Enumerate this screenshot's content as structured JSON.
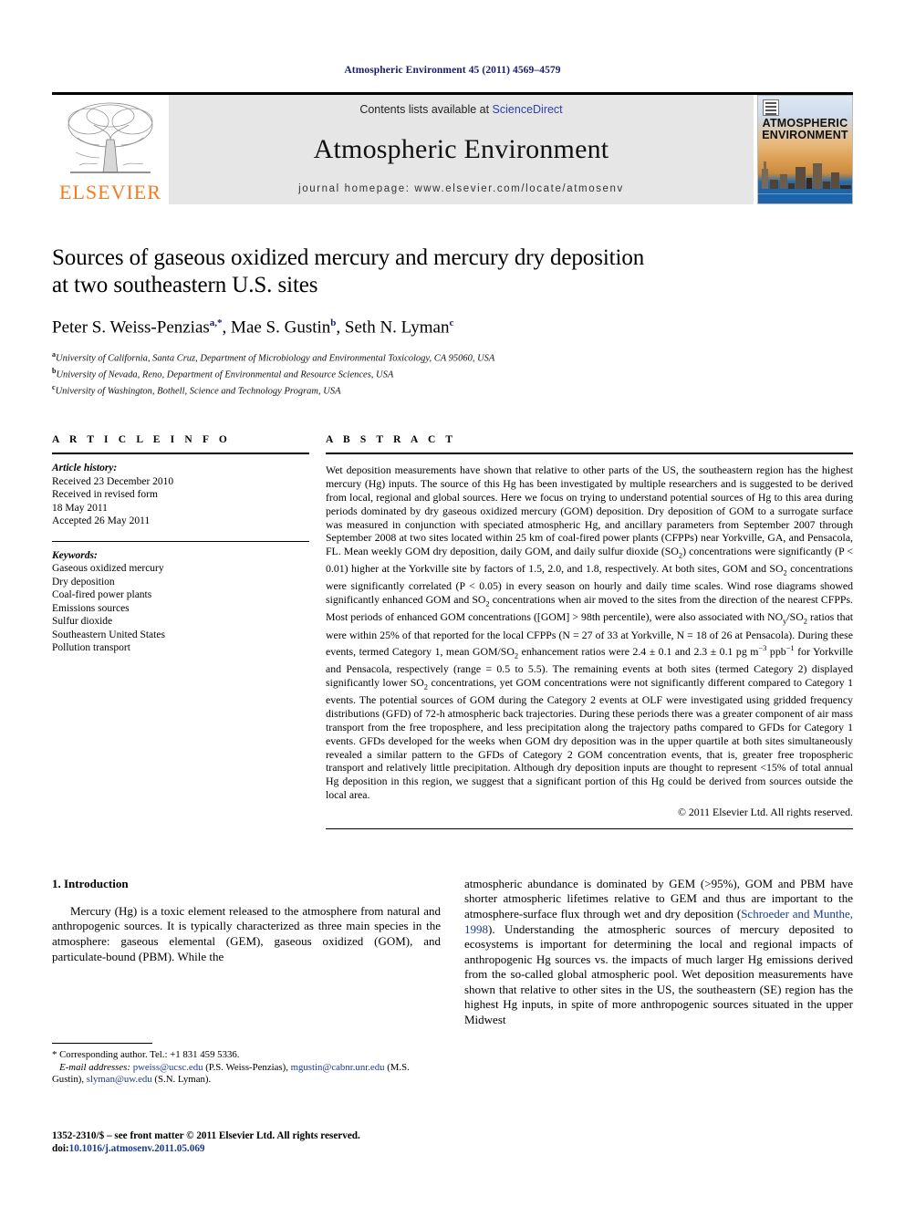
{
  "running_head": "Atmospheric Environment 45 (2011) 4569–4579",
  "masthead": {
    "publisher_name": "ELSEVIER",
    "contents_prefix": "Contents lists available at ",
    "sciencedirect": "ScienceDirect",
    "journal_title": "Atmospheric Environment",
    "homepage_line": "journal homepage: www.elsevier.com/locate/atmosenv",
    "cover_title_line1": "ATMOSPHERIC",
    "cover_title_line2": "ENVIRONMENT"
  },
  "article": {
    "title_line1": "Sources of gaseous oxidized mercury and mercury dry deposition",
    "title_line2": "at two southeastern U.S. sites",
    "authors_plain": "Peter S. Weiss-Penzias a,*, Mae S. Gustin b, Seth N. Lyman c",
    "affiliations": [
      "University of California, Santa Cruz, Department of Microbiology and Environmental Toxicology, CA 95060, USA",
      "University of Nevada, Reno, Department of Environmental and Resource Sciences, USA",
      "University of Washington, Bothell, Science and Technology Program, USA"
    ],
    "affiliation_marks": [
      "a",
      "b",
      "c"
    ]
  },
  "article_info": {
    "heading": "A R T I C L E    I N F O",
    "history_label": "Article history:",
    "history_lines": [
      "Received 23 December 2010",
      "Received in revised form",
      "18 May 2011",
      "Accepted 26 May 2011"
    ],
    "keywords_label": "Keywords:",
    "keywords": [
      "Gaseous oxidized mercury",
      "Dry deposition",
      "Coal-fired power plants",
      "Emissions sources",
      "Sulfur dioxide",
      "Southeastern United States",
      "Pollution transport"
    ]
  },
  "abstract": {
    "heading": "A B S T R A C T",
    "paragraph_part1": "Wet deposition measurements have shown that relative to other parts of the US, the southeastern region has the highest mercury (Hg) inputs. The source of this Hg has been investigated by multiple researchers and is suggested to be derived from local, regional and global sources. Here we focus on trying to understand potential sources of Hg to this area during periods dominated by dry gaseous oxidized mercury (GOM) deposition. Dry deposition of GOM to a surrogate surface was measured in conjunction with speciated atmospheric Hg, and ancillary parameters from September 2007 through September 2008 at two sites located within 25 km of coal-fired power plants (CFPPs) near Yorkville, GA, and Pensacola, FL. Mean weekly GOM dry deposition, daily GOM, and daily sulfur dioxide (SO",
    "paragraph_part2": ") concentrations were significantly (P < 0.01) higher at the Yorkville site by factors of 1.5, 2.0, and 1.8, respectively. At both sites, GOM and SO",
    "paragraph_part3": " concentrations were significantly correlated (P < 0.05) in every season on hourly and daily time scales. Wind rose diagrams showed significantly enhanced GOM and SO",
    "paragraph_part4": " concentrations when air moved to the sites from the direction of the nearest CFPPs. Most periods of enhanced GOM concentrations ([GOM] > 98th percentile), were also associated with NO",
    "paragraph_part5": "/SO",
    "paragraph_part6": " ratios that were within 25% of that reported for the local CFPPs (N = 27 of 33 at Yorkville, N = 18 of 26 at Pensacola). During these events, termed Category 1, mean GOM/SO",
    "paragraph_part7": " enhancement ratios were 2.4 ± 0.1 and 2.3 ± 0.1 pg m",
    "paragraph_part8": " ppb",
    "paragraph_part9": " for Yorkville and Pensacola, respectively (range = 0.5 to 5.5). The remaining events at both sites (termed Category 2) displayed significantly lower SO",
    "paragraph_part10": " concentrations, yet GOM concentrations were not significantly different compared to Category 1 events. The potential sources of GOM during the Category 2 events at OLF were investigated using gridded frequency distributions (GFD) of 72-h atmospheric back trajectories. During these periods there was a greater component of air mass transport from the free troposphere, and less precipitation along the trajectory paths compared to GFDs for Category 1 events. GFDs developed for the weeks when GOM dry deposition was in the upper quartile at both sites simultaneously revealed a similar pattern to the GFDs of Category 2 GOM concentration events, that is, greater free tropospheric transport and relatively little precipitation. Although dry deposition inputs are thought to represent <15% of total annual Hg deposition in this region, we suggest that a significant portion of this Hg could be derived from sources outside the local area.",
    "subscript_2": "2",
    "subscript_y": "y",
    "superscript_minus3": "−3",
    "superscript_minus1": "−1",
    "copyright": "© 2011 Elsevier Ltd. All rights reserved."
  },
  "introduction": {
    "heading": "1. Introduction",
    "left_paragraph": "Mercury (Hg) is a toxic element released to the atmosphere from natural and anthropogenic sources. It is typically characterized as three main species in the atmosphere: gaseous elemental (GEM), gaseous oxidized (GOM), and particulate-bound (PBM). While the",
    "right_part1": "atmospheric abundance is dominated by GEM (>95%), GOM and PBM have shorter atmospheric lifetimes relative to GEM and thus are important to the atmosphere-surface flux through wet and dry deposition (",
    "right_citation": "Schroeder and Munthe, 1998",
    "right_part2": "). Understanding the atmospheric sources of mercury deposited to ecosystems is important for determining the local and regional impacts of anthropogenic Hg sources vs. the impacts of much larger Hg emissions derived from the so-called global atmospheric pool. Wet deposition measurements have shown that relative to other sites in the US, the southeastern (SE) region has the highest Hg inputs, in spite of more anthropogenic sources situated in the upper Midwest"
  },
  "footnote": {
    "corresponding": "* Corresponding author. Tel.: +1 831 459 5336.",
    "email_label": "E-mail addresses:",
    "email1": "pweiss@ucsc.edu",
    "email1_owner": " (P.S. Weiss-Penzias), ",
    "email2": "mgustin@cabnr.unr.edu",
    "email2_owner": " (M.S. Gustin), ",
    "email3": "slyman@uw.edu",
    "email3_owner": " (S.N. Lyman)."
  },
  "issn": {
    "line1": "1352-2310/$ – see front matter © 2011 Elsevier Ltd. All rights reserved.",
    "doi_label": "doi:",
    "doi_value": "10.1016/j.atmosenv.2011.05.069"
  },
  "colors": {
    "running_head": "#1a1a6e",
    "elsevier_orange": "#F47B20",
    "link_blue": "#2b3fae",
    "citation_blue": "#1a3a8f",
    "masthead_grey": "#e6e6e6"
  }
}
